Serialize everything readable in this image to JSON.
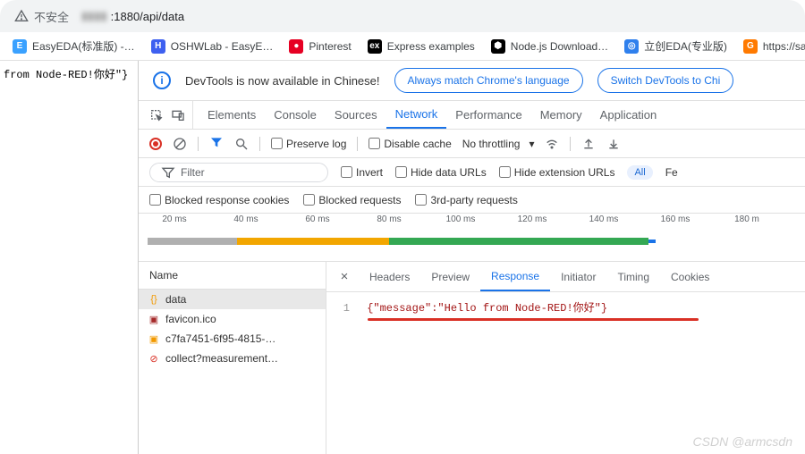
{
  "address": {
    "insecure_label": "不安全",
    "host_masked": "▮▮▮▮",
    "port_path": ":1880/api/data"
  },
  "bookmarks": [
    {
      "label": "EasyEDA(标准版) -…",
      "icon_bg": "#3aa1ff",
      "icon_text": "E"
    },
    {
      "label": "OSHWLab - EasyE…",
      "icon_bg": "#3e60f0",
      "icon_text": "H"
    },
    {
      "label": "Pinterest",
      "icon_bg": "#e60023",
      "icon_text": "●"
    },
    {
      "label": "Express examples",
      "icon_bg": "#000000",
      "icon_text": "ex"
    },
    {
      "label": "Node.js Download…",
      "icon_bg": "#000000",
      "icon_text": "⬢"
    },
    {
      "label": "立创EDA(专业版)",
      "icon_bg": "#2f80ed",
      "icon_text": "◎"
    },
    {
      "label": "https://sapp",
      "icon_bg": "#ff7a00",
      "icon_text": "G"
    }
  ],
  "page_fragment": "from Node-RED!你好\"}",
  "devtools": {
    "info": {
      "msg": "DevTools is now available in Chinese!",
      "btn1": "Always match Chrome's language",
      "btn2": "Switch DevTools to Chi"
    },
    "tabs": [
      "Elements",
      "Console",
      "Sources",
      "Network",
      "Performance",
      "Memory",
      "Application"
    ],
    "active_tab": "Network",
    "toolbar": {
      "preserve_log": "Preserve log",
      "disable_cache": "Disable cache",
      "throttling": "No throttling"
    },
    "filter": {
      "placeholder": "Filter",
      "invert": "Invert",
      "hide_data_urls": "Hide data URLs",
      "hide_ext_urls": "Hide extension URLs",
      "all_pill": "All",
      "fe_pill": "Fe"
    },
    "filter2": {
      "blocked_cookies": "Blocked response cookies",
      "blocked_req": "Blocked requests",
      "third_party": "3rd-party requests"
    },
    "timeline_ticks": [
      "20 ms",
      "40 ms",
      "60 ms",
      "80 ms",
      "100 ms",
      "120 ms",
      "140 ms",
      "160 ms",
      "180 m"
    ],
    "name_header": "Name",
    "requests": [
      {
        "name": "data",
        "icon_color": "#f29900",
        "icon": "{}"
      },
      {
        "name": "favicon.ico",
        "icon_color": "#a52a2a",
        "icon": "▣"
      },
      {
        "name": "c7fa7451-6f95-4815-…",
        "icon_color": "#f29900",
        "icon": "▣"
      },
      {
        "name": "collect?measurement…",
        "icon_color": "#d93025",
        "icon": "⊘"
      }
    ],
    "detail_tabs": [
      "Headers",
      "Preview",
      "Response",
      "Initiator",
      "Timing",
      "Cookies"
    ],
    "detail_active": "Response",
    "response_line_no": "1",
    "response_body": "{\"message\":\"Hello from Node-RED!你好\"}"
  },
  "watermark": "CSDN @armcsdn"
}
